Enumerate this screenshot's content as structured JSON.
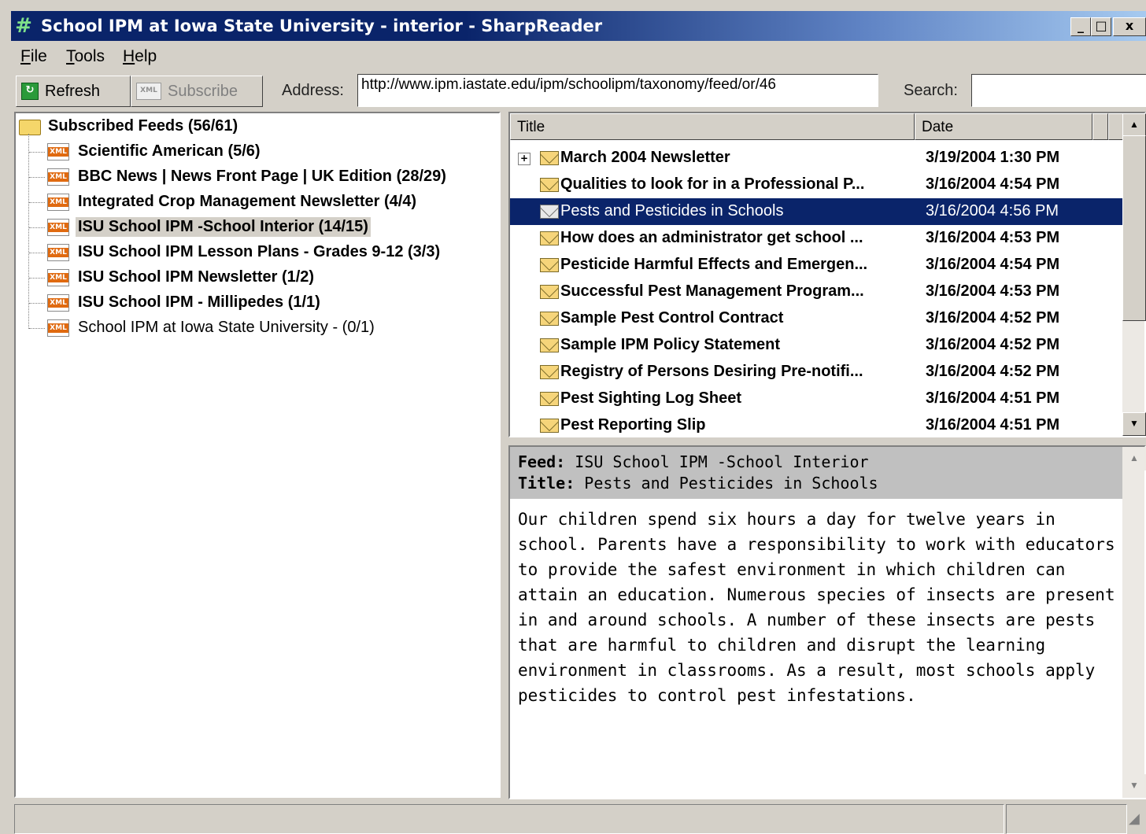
{
  "window": {
    "title": "School IPM at Iowa State University - interior - SharpReader",
    "icon": "hash-icon",
    "controls": [
      "_",
      "□",
      "x"
    ]
  },
  "menu": [
    {
      "label": "File",
      "accel": "F",
      "rest": "ile"
    },
    {
      "label": "Tools",
      "accel": "T",
      "rest": "ools"
    },
    {
      "label": "Help",
      "accel": "H",
      "rest": "elp"
    }
  ],
  "toolbar": {
    "refresh_label": "Refresh",
    "subscribe_label": "Subscribe",
    "address_label": "Address:",
    "address_value": "http://www.ipm.iastate.edu/ipm/schoolipm/taxonomy/feed/or/46",
    "search_label": "Search:",
    "search_value": ""
  },
  "tree": {
    "root": "Subscribed Feeds (56/61)",
    "feeds": [
      {
        "label": "Scientific American (5/6)",
        "unread": true
      },
      {
        "label": "BBC News | News Front Page | UK Edition (28/29)",
        "unread": true
      },
      {
        "label": "Integrated Crop Management Newsletter (4/4)",
        "unread": true
      },
      {
        "label": "ISU School IPM -School Interior (14/15)",
        "unread": true,
        "selected": true
      },
      {
        "label": "ISU School IPM Lesson Plans - Grades 9-12 (3/3)",
        "unread": true
      },
      {
        "label": "ISU School IPM Newsletter (1/2)",
        "unread": true
      },
      {
        "label": "ISU School IPM - Millipedes (1/1)",
        "unread": true
      },
      {
        "label": "School IPM at Iowa State University - (0/1)",
        "unread": false
      }
    ],
    "xml_badge": "XML"
  },
  "list": {
    "columns": {
      "title": "Title",
      "date": "Date"
    },
    "items": [
      {
        "title": "March 2004 Newsletter",
        "date": "3/19/2004 1:30 PM",
        "unread": true,
        "expander": "+"
      },
      {
        "title": "Qualities to look for in a Professional P...",
        "date": "3/16/2004 4:54 PM",
        "unread": true
      },
      {
        "title": "Pests and Pesticides in Schools",
        "date": "3/16/2004 4:56 PM",
        "unread": false,
        "selected": true
      },
      {
        "title": "How does an administrator get school ...",
        "date": "3/16/2004 4:53 PM",
        "unread": true
      },
      {
        "title": "Pesticide Harmful Effects and Emergen...",
        "date": "3/16/2004 4:54 PM",
        "unread": true
      },
      {
        "title": "Successful Pest Management Program...",
        "date": "3/16/2004 4:53 PM",
        "unread": true
      },
      {
        "title": "Sample Pest Control Contract",
        "date": "3/16/2004 4:52 PM",
        "unread": true
      },
      {
        "title": "Sample IPM Policy Statement",
        "date": "3/16/2004 4:52 PM",
        "unread": true
      },
      {
        "title": "Registry of Persons Desiring Pre-notifi...",
        "date": "3/16/2004 4:52 PM",
        "unread": true
      },
      {
        "title": "Pest Sighting Log Sheet",
        "date": "3/16/2004 4:51 PM",
        "unread": true
      },
      {
        "title": "Pest Reporting Slip",
        "date": "3/16/2004 4:51 PM",
        "unread": true
      }
    ]
  },
  "reader": {
    "feed_label": "Feed:",
    "feed_value": "ISU School IPM -School Interior",
    "title_label": "Title:",
    "title_value": "Pests and Pesticides in Schools",
    "body": "Our children spend six hours a day for twelve years in school. Parents have a responsibility to work with educators to provide the safest environment in which children can attain an education. Numerous species of insects are present in and around schools. A number of these insects are pests that are harmful to children and disrupt the learning environment in classrooms. As a result, most schools apply pesticides to control pest infestations."
  },
  "colors": {
    "selection": "#0a246a",
    "face": "#d4d0c8",
    "xml_orange": "#e06a10"
  }
}
